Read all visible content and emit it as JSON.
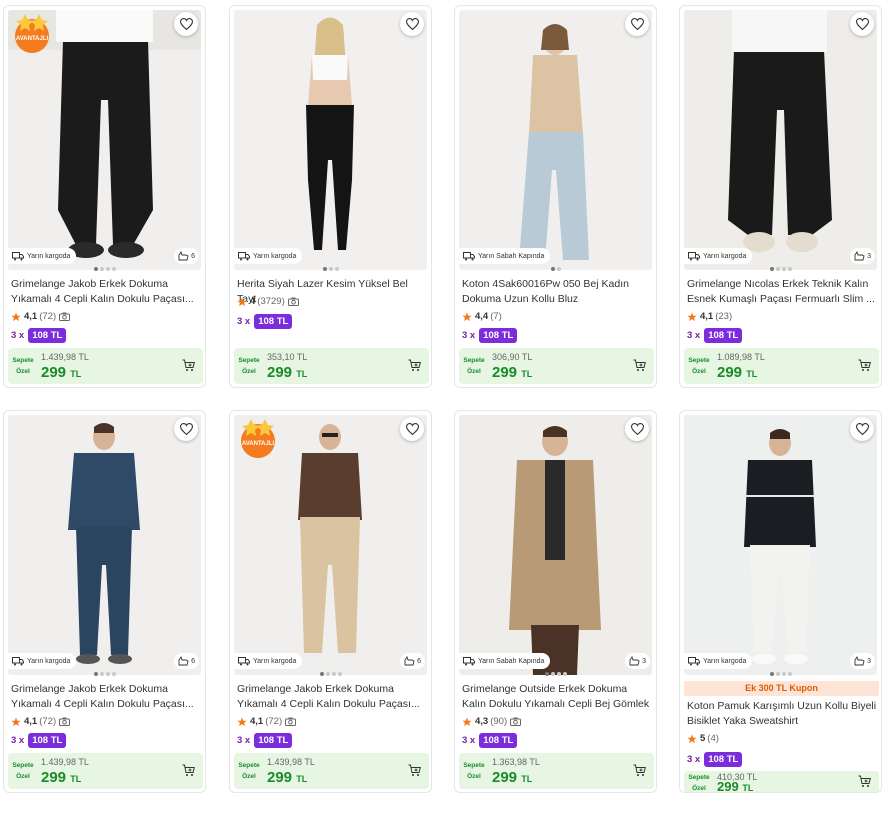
{
  "products": [
    {
      "name": "Grimelange Jakob Erkek Dokuma Yıkamalı 4 Cepli Kalın Dokulu Paçası...",
      "rating": "4,1",
      "count": "(72)",
      "camera": true,
      "shipping": "Yarın kargoda",
      "views": "6",
      "installment": "3 x",
      "installment_price": "108 TL",
      "price_label": "Sepete Özel",
      "old_price": "1.439,98 TL",
      "new_price": "299",
      "currency": "TL",
      "badge": "AVANTAJLI",
      "dots": 4
    },
    {
      "name": "Herita Siyah Lazer Kesim Yüksel Bel Tayt",
      "rating": "4",
      "count": "(3729)",
      "camera": true,
      "shipping": "Yarın kargoda",
      "views": "",
      "installment": "3 x",
      "installment_price": "108 TL",
      "price_label": "Sepete Özel",
      "old_price": "353,10 TL",
      "new_price": "299",
      "currency": "TL",
      "badge": "",
      "dots": 3
    },
    {
      "name": "Koton 4Sak60016Pw 050 Bej Kadın Dokuma Uzun Kollu Bluz",
      "rating": "4,4",
      "count": "(7)",
      "camera": false,
      "shipping": "Yarın Sabah Kapında",
      "views": "",
      "installment": "3 x",
      "installment_price": "108 TL",
      "price_label": "Sepete Özel",
      "old_price": "306,90 TL",
      "new_price": "299",
      "currency": "TL",
      "badge": "",
      "dots": 2
    },
    {
      "name": "Grimelange Nıcolas Erkek Teknik Kalın Esnek Kumaşlı Paçası Fermuarlı Slim ...",
      "rating": "4,1",
      "count": "(23)",
      "camera": false,
      "shipping": "Yarın kargoda",
      "views": "3",
      "installment": "3 x",
      "installment_price": "108 TL",
      "price_label": "Sepete Özel",
      "old_price": "1.089,98 TL",
      "new_price": "299",
      "currency": "TL",
      "badge": "",
      "dots": 4
    },
    {
      "name": "Grimelange Jakob Erkek Dokuma Yıkamalı 4 Cepli Kalın Dokulu Paçası...",
      "rating": "4,1",
      "count": "(72)",
      "camera": true,
      "shipping": "Yarın kargoda",
      "views": "6",
      "installment": "3 x",
      "installment_price": "108 TL",
      "price_label": "Sepete Özel",
      "old_price": "1.439,98 TL",
      "new_price": "299",
      "currency": "TL",
      "badge": "",
      "dots": 4
    },
    {
      "name": "Grimelange Jakob Erkek Dokuma Yıkamalı 4 Cepli Kalın Dokulu Paçası...",
      "rating": "4,1",
      "count": "(72)",
      "camera": true,
      "shipping": "Yarın kargoda",
      "views": "6",
      "installment": "3 x",
      "installment_price": "108 TL",
      "price_label": "Sepete Özel",
      "old_price": "1.439,98 TL",
      "new_price": "299",
      "currency": "TL",
      "badge": "AVANTAJLI",
      "dots": 4
    },
    {
      "name": "Grimelange Outside Erkek Dokuma Kalın Dokulu Yıkamalı Cepli Bej Gömlek",
      "rating": "4,3",
      "count": "(90)",
      "camera": true,
      "shipping": "Yarın Sabah Kapında",
      "views": "3",
      "installment": "3 x",
      "installment_price": "108 TL",
      "price_label": "Sepete Özel",
      "old_price": "1.363,98 TL",
      "new_price": "299",
      "currency": "TL",
      "badge": "",
      "dots": 4
    },
    {
      "name": "Koton Pamuk Karışımlı Uzun Kollu Biyeli Bisiklet Yaka Sweatshirt",
      "rating": "5",
      "count": "(4)",
      "camera": false,
      "shipping": "Yarın kargoda",
      "views": "3",
      "installment": "3 x",
      "installment_price": "108 TL",
      "price_label": "Sepete Özel",
      "old_price": "410,30 TL",
      "new_price": "299",
      "currency": "TL",
      "badge": "",
      "dots": 4,
      "coupon": "Ek 300 TL Kupon"
    }
  ],
  "colors": {
    "accent_purple": "#7b2ddb",
    "price_green": "#1a8b2b",
    "price_bg": "#e6f6e3",
    "star": "#f27a1a",
    "coupon_bg": "#fde4d7",
    "coupon_text": "#e05b00"
  },
  "icons": {
    "favorite": "heart-outline-icon",
    "cart": "add-to-cart-icon",
    "shipping": "delivery-truck-icon",
    "views": "hand-views-icon",
    "star": "star-icon",
    "camera": "camera-icon"
  }
}
